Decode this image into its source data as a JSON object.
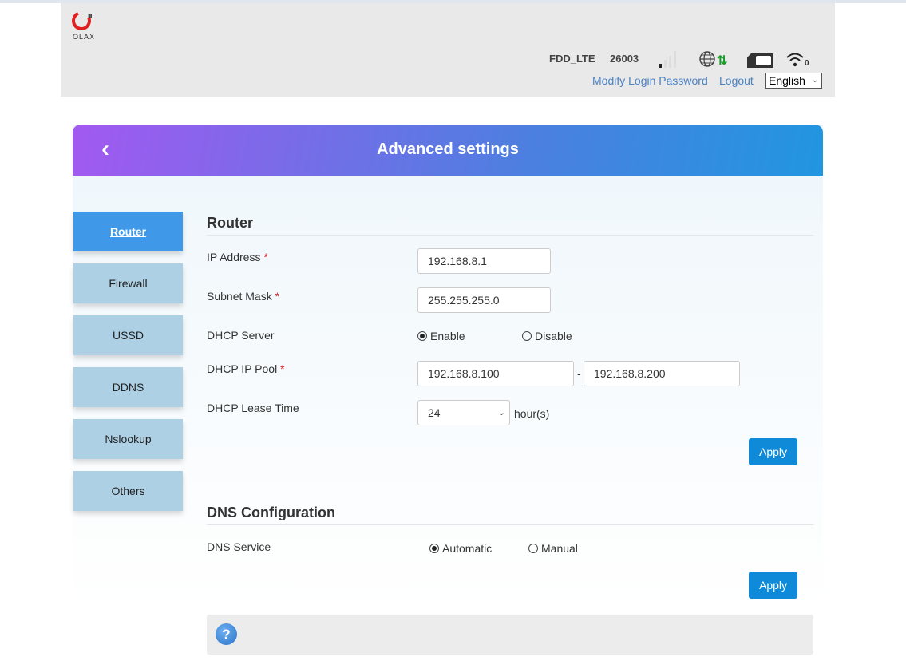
{
  "header": {
    "logo_text": "OLAX",
    "network_type": "FDD_LTE",
    "operator": "26003",
    "wifi_clients": "0",
    "modify_password": "Modify Login Password",
    "logout": "Logout",
    "language": "English"
  },
  "banner": {
    "title": "Advanced settings"
  },
  "sidebar": {
    "items": [
      {
        "label": "Router"
      },
      {
        "label": "Firewall"
      },
      {
        "label": "USSD"
      },
      {
        "label": "DDNS"
      },
      {
        "label": "Nslookup"
      },
      {
        "label": "Others"
      }
    ]
  },
  "router": {
    "title": "Router",
    "ip_label": "IP Address",
    "ip_value": "192.168.8.1",
    "mask_label": "Subnet Mask",
    "mask_value": "255.255.255.0",
    "dhcp_label": "DHCP Server",
    "enable": "Enable",
    "disable": "Disable",
    "pool_label": "DHCP IP Pool",
    "pool_start": "192.168.8.100",
    "pool_sep": "-",
    "pool_end": "192.168.8.200",
    "lease_label": "DHCP Lease Time",
    "lease_value": "24",
    "lease_unit": "hour(s)",
    "apply": "Apply",
    "required": "*"
  },
  "dns": {
    "title": "DNS Configuration",
    "service_label": "DNS Service",
    "automatic": "Automatic",
    "manual": "Manual",
    "apply": "Apply"
  },
  "help": {
    "icon": "?"
  }
}
